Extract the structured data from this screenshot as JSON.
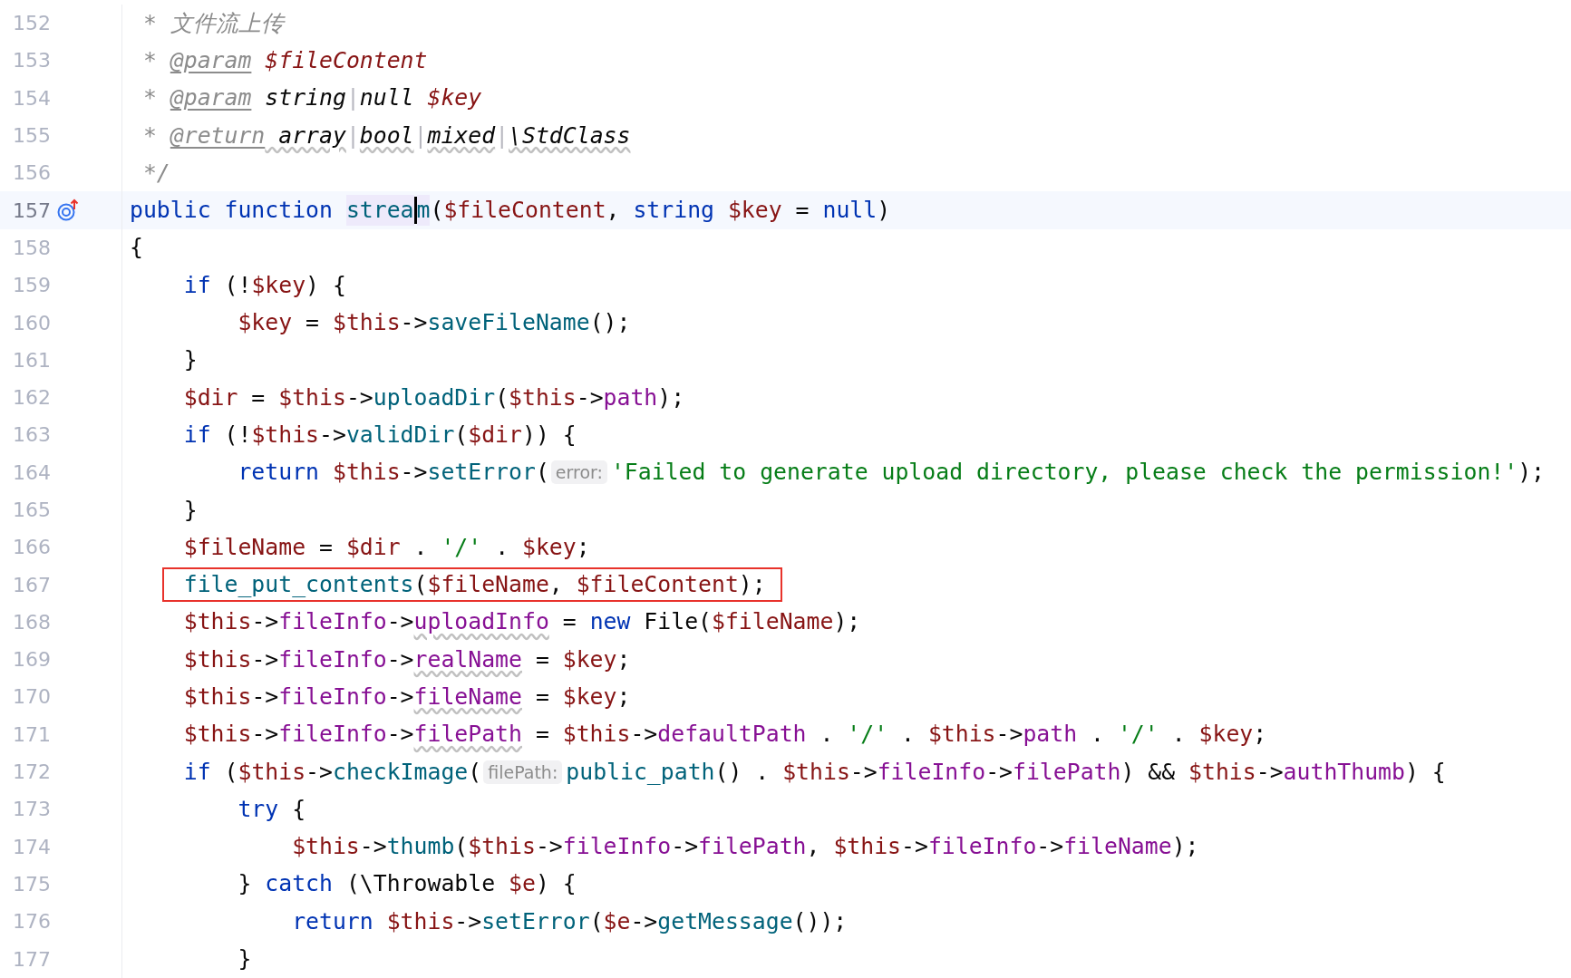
{
  "lines": [
    {
      "number": "152",
      "current": false,
      "boxed": false,
      "implemented": false,
      "code": [
        {
          "text": " * 文件流上传",
          "kind": "comment"
        }
      ]
    },
    {
      "number": "153",
      "current": false,
      "boxed": false,
      "implemented": false,
      "code": [
        {
          "text": " * ",
          "kind": "comment"
        },
        {
          "text": "@param",
          "kind": "doctag"
        },
        {
          "text": " $fileContent",
          "kind": "docvar"
        }
      ]
    },
    {
      "number": "154",
      "current": false,
      "boxed": false,
      "implemented": false,
      "code": [
        {
          "text": " * ",
          "kind": "comment"
        },
        {
          "text": "@param",
          "kind": "doctag"
        },
        {
          "text": " string",
          "kind": "doctype"
        },
        {
          "text": "|",
          "kind": "pipe"
        },
        {
          "text": "null",
          "kind": "doctype"
        },
        {
          "text": " $key",
          "kind": "docvar"
        }
      ]
    },
    {
      "number": "155",
      "current": false,
      "boxed": false,
      "implemented": false,
      "code": [
        {
          "text": " * ",
          "kind": "comment"
        },
        {
          "text": "@return",
          "kind": "doctag"
        },
        {
          "text": " array",
          "kind": "doctype",
          "wavy": true
        },
        {
          "text": "|",
          "kind": "pipe"
        },
        {
          "text": "bool",
          "kind": "doctype",
          "wavy": true
        },
        {
          "text": "|",
          "kind": "pipe"
        },
        {
          "text": "mixed",
          "kind": "doctype",
          "wavy": true
        },
        {
          "text": "|",
          "kind": "pipe"
        },
        {
          "text": "\\StdClass",
          "kind": "doctype",
          "wavy": true
        }
      ]
    },
    {
      "number": "156",
      "current": false,
      "boxed": false,
      "implemented": false,
      "code": [
        {
          "text": " */",
          "kind": "comment"
        }
      ]
    },
    {
      "number": "157",
      "current": true,
      "boxed": false,
      "implemented": true,
      "code": [
        {
          "text": "public function ",
          "kind": "keyword"
        },
        {
          "text": "strea",
          "kind": "fn",
          "marked": true
        },
        {
          "kind": "caret"
        },
        {
          "text": "m",
          "kind": "fn",
          "marked": true
        },
        {
          "text": "(",
          "kind": "plain"
        },
        {
          "text": "$fileContent",
          "kind": "var"
        },
        {
          "text": ", ",
          "kind": "plain"
        },
        {
          "text": "string ",
          "kind": "keyword"
        },
        {
          "text": "$key",
          "kind": "var"
        },
        {
          "text": " = ",
          "kind": "plain"
        },
        {
          "text": "null",
          "kind": "keyword"
        },
        {
          "text": ")",
          "kind": "plain"
        }
      ]
    },
    {
      "number": "158",
      "current": false,
      "boxed": false,
      "implemented": false,
      "code": [
        {
          "text": "{",
          "kind": "plain"
        }
      ],
      "children": [
        {
          "number": "159",
          "current": false,
          "boxed": false,
          "implemented": false,
          "code": [
            {
              "text": "if ",
              "kind": "keyword"
            },
            {
              "text": "(!",
              "kind": "plain"
            },
            {
              "text": "$key",
              "kind": "var"
            },
            {
              "text": ") {",
              "kind": "plain"
            }
          ],
          "children": [
            {
              "number": "160",
              "current": false,
              "boxed": false,
              "implemented": false,
              "code": [
                {
                  "text": "$key",
                  "kind": "var"
                },
                {
                  "text": " = ",
                  "kind": "plain"
                },
                {
                  "text": "$this",
                  "kind": "var"
                },
                {
                  "text": "->",
                  "kind": "plain"
                },
                {
                  "text": "saveFileName",
                  "kind": "fn"
                },
                {
                  "text": "();",
                  "kind": "plain"
                }
              ]
            }
          ]
        },
        {
          "number": "161",
          "current": false,
          "boxed": false,
          "implemented": false,
          "code": [
            {
              "text": "}",
              "kind": "plain"
            }
          ]
        },
        {
          "number": "162",
          "current": false,
          "boxed": false,
          "implemented": false,
          "code": [
            {
              "text": "$dir",
              "kind": "var"
            },
            {
              "text": " = ",
              "kind": "plain"
            },
            {
              "text": "$this",
              "kind": "var"
            },
            {
              "text": "->",
              "kind": "plain"
            },
            {
              "text": "uploadDir",
              "kind": "fn"
            },
            {
              "text": "(",
              "kind": "plain"
            },
            {
              "text": "$this",
              "kind": "var"
            },
            {
              "text": "->",
              "kind": "plain"
            },
            {
              "text": "path",
              "kind": "prop"
            },
            {
              "text": ");",
              "kind": "plain"
            }
          ]
        },
        {
          "number": "163",
          "current": false,
          "boxed": false,
          "implemented": false,
          "code": [
            {
              "text": "if ",
              "kind": "keyword"
            },
            {
              "text": "(!",
              "kind": "plain"
            },
            {
              "text": "$this",
              "kind": "var"
            },
            {
              "text": "->",
              "kind": "plain"
            },
            {
              "text": "validDir",
              "kind": "fn"
            },
            {
              "text": "(",
              "kind": "plain"
            },
            {
              "text": "$dir",
              "kind": "var"
            },
            {
              "text": ")) {",
              "kind": "plain"
            }
          ],
          "children": [
            {
              "number": "164",
              "current": false,
              "boxed": false,
              "implemented": false,
              "code": [
                {
                  "text": "return ",
                  "kind": "keyword"
                },
                {
                  "text": "$this",
                  "kind": "var"
                },
                {
                  "text": "->",
                  "kind": "plain"
                },
                {
                  "text": "setError",
                  "kind": "fn"
                },
                {
                  "text": "(",
                  "kind": "plain"
                },
                {
                  "text": "error:",
                  "kind": "hint"
                },
                {
                  "text": "'Failed to generate upload directory, please check the permission!'",
                  "kind": "str"
                },
                {
                  "text": ");",
                  "kind": "plain"
                }
              ]
            }
          ]
        },
        {
          "number": "165",
          "current": false,
          "boxed": false,
          "implemented": false,
          "code": [
            {
              "text": "}",
              "kind": "plain"
            }
          ]
        },
        {
          "number": "166",
          "current": false,
          "boxed": false,
          "implemented": false,
          "code": [
            {
              "text": "$fileName",
              "kind": "var"
            },
            {
              "text": " = ",
              "kind": "plain"
            },
            {
              "text": "$dir",
              "kind": "var"
            },
            {
              "text": " . ",
              "kind": "plain"
            },
            {
              "text": "'/'",
              "kind": "str"
            },
            {
              "text": " . ",
              "kind": "plain"
            },
            {
              "text": "$key",
              "kind": "var"
            },
            {
              "text": ";",
              "kind": "plain"
            }
          ]
        },
        {
          "number": "167",
          "current": false,
          "boxed": true,
          "implemented": false,
          "code": [
            {
              "text": "file_put_contents",
              "kind": "fn"
            },
            {
              "text": "(",
              "kind": "plain"
            },
            {
              "text": "$fileName",
              "kind": "var"
            },
            {
              "text": ", ",
              "kind": "plain"
            },
            {
              "text": "$fileContent",
              "kind": "var"
            },
            {
              "text": ");",
              "kind": "plain"
            }
          ]
        },
        {
          "number": "168",
          "current": false,
          "boxed": false,
          "implemented": false,
          "code": [
            {
              "text": "$this",
              "kind": "var"
            },
            {
              "text": "->",
              "kind": "plain"
            },
            {
              "text": "fileInfo",
              "kind": "prop"
            },
            {
              "text": "->",
              "kind": "plain"
            },
            {
              "text": "uploadInfo",
              "kind": "prop",
              "wavy": true
            },
            {
              "text": " = ",
              "kind": "plain"
            },
            {
              "text": "new ",
              "kind": "keyword"
            },
            {
              "text": "File(",
              "kind": "plain"
            },
            {
              "text": "$fileName",
              "kind": "var"
            },
            {
              "text": ");",
              "kind": "plain"
            }
          ]
        },
        {
          "number": "169",
          "current": false,
          "boxed": false,
          "implemented": false,
          "code": [
            {
              "text": "$this",
              "kind": "var"
            },
            {
              "text": "->",
              "kind": "plain"
            },
            {
              "text": "fileInfo",
              "kind": "prop"
            },
            {
              "text": "->",
              "kind": "plain"
            },
            {
              "text": "realName",
              "kind": "prop",
              "wavy": true
            },
            {
              "text": " = ",
              "kind": "plain"
            },
            {
              "text": "$key",
              "kind": "var"
            },
            {
              "text": ";",
              "kind": "plain"
            }
          ]
        },
        {
          "number": "170",
          "current": false,
          "boxed": false,
          "implemented": false,
          "code": [
            {
              "text": "$this",
              "kind": "var"
            },
            {
              "text": "->",
              "kind": "plain"
            },
            {
              "text": "fileInfo",
              "kind": "prop"
            },
            {
              "text": "->",
              "kind": "plain"
            },
            {
              "text": "fileName",
              "kind": "prop",
              "wavy": true
            },
            {
              "text": " = ",
              "kind": "plain"
            },
            {
              "text": "$key",
              "kind": "var"
            },
            {
              "text": ";",
              "kind": "plain"
            }
          ]
        },
        {
          "number": "171",
          "current": false,
          "boxed": false,
          "implemented": false,
          "code": [
            {
              "text": "$this",
              "kind": "var"
            },
            {
              "text": "->",
              "kind": "plain"
            },
            {
              "text": "fileInfo",
              "kind": "prop"
            },
            {
              "text": "->",
              "kind": "plain"
            },
            {
              "text": "filePath",
              "kind": "prop",
              "wavy": true
            },
            {
              "text": " = ",
              "kind": "plain"
            },
            {
              "text": "$this",
              "kind": "var"
            },
            {
              "text": "->",
              "kind": "plain"
            },
            {
              "text": "defaultPath",
              "kind": "prop"
            },
            {
              "text": " . ",
              "kind": "plain"
            },
            {
              "text": "'/'",
              "kind": "str"
            },
            {
              "text": " . ",
              "kind": "plain"
            },
            {
              "text": "$this",
              "kind": "var"
            },
            {
              "text": "->",
              "kind": "plain"
            },
            {
              "text": "path",
              "kind": "prop"
            },
            {
              "text": " . ",
              "kind": "plain"
            },
            {
              "text": "'/'",
              "kind": "str"
            },
            {
              "text": " . ",
              "kind": "plain"
            },
            {
              "text": "$key",
              "kind": "var"
            },
            {
              "text": ";",
              "kind": "plain"
            }
          ]
        },
        {
          "number": "172",
          "current": false,
          "boxed": false,
          "implemented": false,
          "code": [
            {
              "text": "if ",
              "kind": "keyword"
            },
            {
              "text": "(",
              "kind": "plain"
            },
            {
              "text": "$this",
              "kind": "var"
            },
            {
              "text": "->",
              "kind": "plain"
            },
            {
              "text": "checkImage",
              "kind": "fn"
            },
            {
              "text": "(",
              "kind": "plain"
            },
            {
              "text": "filePath:",
              "kind": "hint"
            },
            {
              "text": "public_path",
              "kind": "fn"
            },
            {
              "text": "() . ",
              "kind": "plain"
            },
            {
              "text": "$this",
              "kind": "var"
            },
            {
              "text": "->",
              "kind": "plain"
            },
            {
              "text": "fileInfo",
              "kind": "prop"
            },
            {
              "text": "->",
              "kind": "plain"
            },
            {
              "text": "filePath",
              "kind": "prop"
            },
            {
              "text": ") && ",
              "kind": "plain"
            },
            {
              "text": "$this",
              "kind": "var"
            },
            {
              "text": "->",
              "kind": "plain"
            },
            {
              "text": "authThumb",
              "kind": "prop"
            },
            {
              "text": ") {",
              "kind": "plain"
            }
          ],
          "children": [
            {
              "number": "173",
              "current": false,
              "boxed": false,
              "implemented": false,
              "code": [
                {
                  "text": "try ",
                  "kind": "keyword"
                },
                {
                  "text": "{",
                  "kind": "plain"
                }
              ],
              "children": [
                {
                  "number": "174",
                  "current": false,
                  "boxed": false,
                  "implemented": false,
                  "code": [
                    {
                      "text": "$this",
                      "kind": "var"
                    },
                    {
                      "text": "->",
                      "kind": "plain"
                    },
                    {
                      "text": "thumb",
                      "kind": "fn"
                    },
                    {
                      "text": "(",
                      "kind": "plain"
                    },
                    {
                      "text": "$this",
                      "kind": "var"
                    },
                    {
                      "text": "->",
                      "kind": "plain"
                    },
                    {
                      "text": "fileInfo",
                      "kind": "prop"
                    },
                    {
                      "text": "->",
                      "kind": "plain"
                    },
                    {
                      "text": "filePath",
                      "kind": "prop"
                    },
                    {
                      "text": ", ",
                      "kind": "plain"
                    },
                    {
                      "text": "$this",
                      "kind": "var"
                    },
                    {
                      "text": "->",
                      "kind": "plain"
                    },
                    {
                      "text": "fileInfo",
                      "kind": "prop"
                    },
                    {
                      "text": "->",
                      "kind": "plain"
                    },
                    {
                      "text": "fileName",
                      "kind": "prop"
                    },
                    {
                      "text": ");",
                      "kind": "plain"
                    }
                  ]
                }
              ]
            },
            {
              "number": "175",
              "current": false,
              "boxed": false,
              "implemented": false,
              "code": [
                {
                  "text": "} ",
                  "kind": "plain"
                },
                {
                  "text": "catch ",
                  "kind": "keyword"
                },
                {
                  "text": "(\\Throwable ",
                  "kind": "plain"
                },
                {
                  "text": "$e",
                  "kind": "var"
                },
                {
                  "text": ") {",
                  "kind": "plain"
                }
              ],
              "children": [
                {
                  "number": "176",
                  "current": false,
                  "boxed": false,
                  "implemented": false,
                  "code": [
                    {
                      "text": "return ",
                      "kind": "keyword"
                    },
                    {
                      "text": "$this",
                      "kind": "var"
                    },
                    {
                      "text": "->",
                      "kind": "plain"
                    },
                    {
                      "text": "setError",
                      "kind": "fn"
                    },
                    {
                      "text": "(",
                      "kind": "plain"
                    },
                    {
                      "text": "$e",
                      "kind": "var"
                    },
                    {
                      "text": "->",
                      "kind": "plain"
                    },
                    {
                      "text": "getMessage",
                      "kind": "fn"
                    },
                    {
                      "text": "());",
                      "kind": "plain"
                    }
                  ]
                }
              ]
            },
            {
              "number": "177",
              "current": false,
              "boxed": false,
              "implemented": false,
              "code": [
                {
                  "text": "}",
                  "kind": "plain"
                }
              ]
            }
          ]
        }
      ]
    }
  ]
}
